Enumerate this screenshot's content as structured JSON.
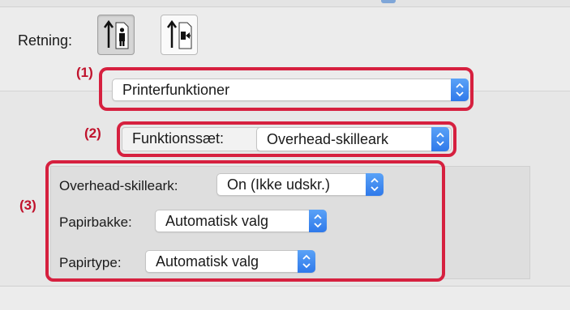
{
  "orientation": {
    "label": "Retning:",
    "options": [
      {
        "name": "portrait",
        "selected": true
      },
      {
        "name": "landscape",
        "selected": false
      }
    ]
  },
  "callouts": {
    "c1": "(1)",
    "c2": "(2)",
    "c3": "(3)"
  },
  "panel_select": {
    "value": "Printerfunktioner"
  },
  "feature_set": {
    "label": "Funktionssæt:",
    "value": "Overhead-skilleark"
  },
  "settings": {
    "overhead": {
      "label": "Overhead-skilleark:",
      "value": "On (Ikke udskr.)"
    },
    "paper_tray": {
      "label": "Papirbakke:",
      "value": "Automatisk valg"
    },
    "paper_type": {
      "label": "Papirtype:",
      "value": "Automatisk valg"
    }
  },
  "colors": {
    "callout": "#d6203f",
    "stepper": "#3b82f0"
  }
}
